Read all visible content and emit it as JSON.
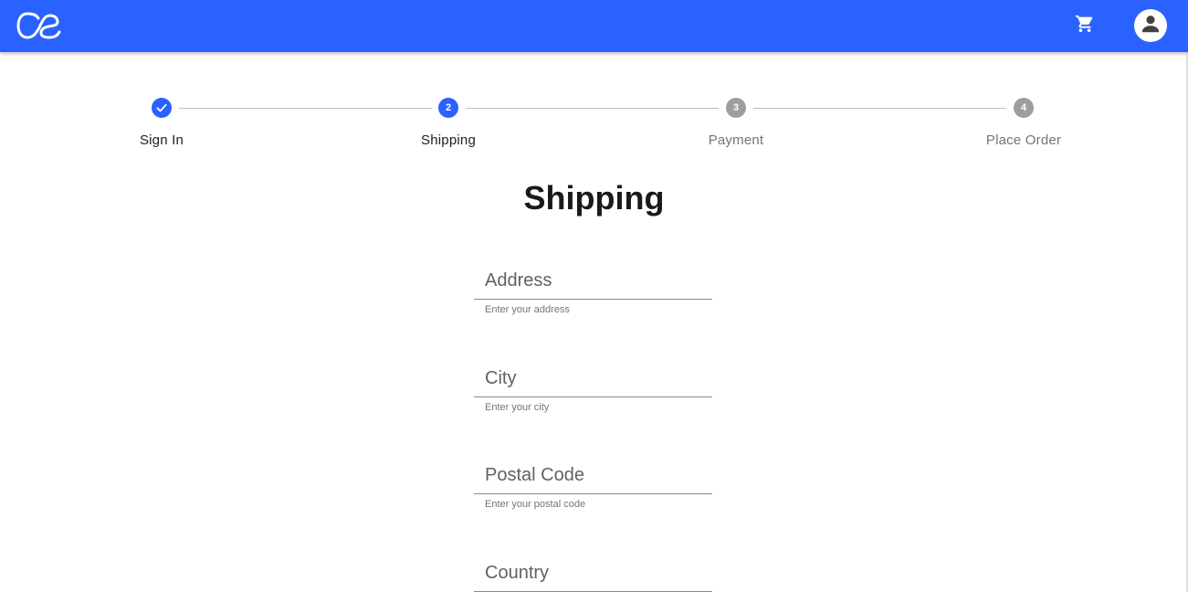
{
  "appbar": {
    "brand_color": "#2962ff",
    "logo_icon": "lastfm-logo-icon",
    "cart_icon": "shopping-cart-icon",
    "account_icon": "account-circle-icon"
  },
  "stepper": {
    "steps": [
      {
        "label": "Sign In",
        "number": "1",
        "state": "completed"
      },
      {
        "label": "Shipping",
        "number": "2",
        "state": "active"
      },
      {
        "label": "Payment",
        "number": "3",
        "state": "pending"
      },
      {
        "label": "Place Order",
        "number": "4",
        "state": "pending"
      }
    ]
  },
  "page": {
    "title": "Shipping"
  },
  "form": {
    "address": {
      "placeholder": "Address",
      "helper": "Enter your address",
      "value": ""
    },
    "city": {
      "placeholder": "City",
      "helper": "Enter your city",
      "value": ""
    },
    "postal_code": {
      "placeholder": "Postal Code",
      "helper": "Enter your postal code",
      "value": ""
    },
    "country": {
      "placeholder": "Country",
      "value": ""
    }
  }
}
